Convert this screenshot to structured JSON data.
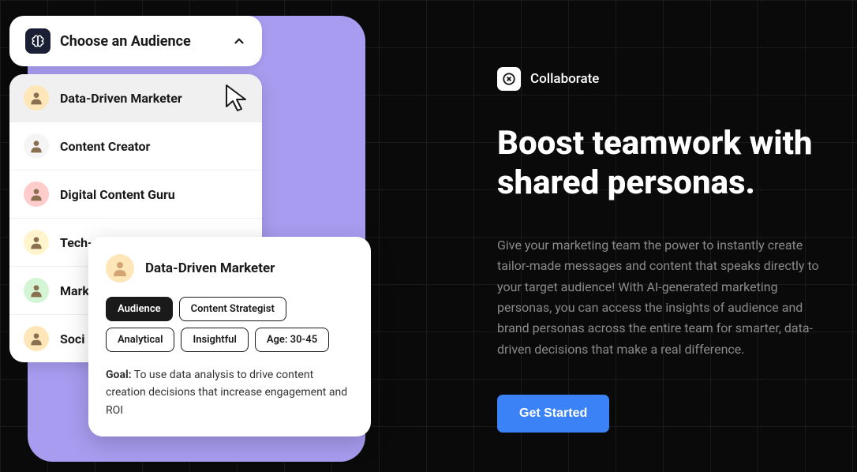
{
  "dropdown": {
    "label": "Choose an Audience",
    "items": [
      {
        "name": "Data-Driven Marketer",
        "selected": true,
        "avatar_bg": "#ffe6b8"
      },
      {
        "name": "Content Creator",
        "selected": false,
        "avatar_bg": "#f5f5f5"
      },
      {
        "name": "Digital Content Guru",
        "selected": false,
        "avatar_bg": "#ffcccc"
      },
      {
        "name": "Tech-savvy Influencer",
        "selected": false,
        "avatar_bg": "#fff4cc"
      },
      {
        "name": "Mark",
        "selected": false,
        "avatar_bg": "#d4f5d4"
      },
      {
        "name": "Soci",
        "selected": false,
        "avatar_bg": "#ffe6b8"
      }
    ]
  },
  "persona": {
    "title": "Data-Driven Marketer",
    "avatar_bg": "#ffe6b8",
    "tags": [
      {
        "label": "Audience",
        "active": true
      },
      {
        "label": "Content Strategist",
        "active": false
      },
      {
        "label": "Analytical",
        "active": false
      },
      {
        "label": "Insightful",
        "active": false
      },
      {
        "label": "Age: 30-45",
        "active": false
      }
    ],
    "goal_label": "Goal:",
    "goal_text": " To use data analysis to drive content creation decisions that increase engagement and ROI"
  },
  "right": {
    "badge": "Collaborate",
    "headline": "Boost teamwork with shared personas.",
    "description": "Give your marketing team the power to instantly create tailor-made messages and content that speaks directly to your target audience! With AI-generated marketing personas, you can access the insights of audience and brand personas across the entire team for smarter, data-driven decisions that make a real difference.",
    "cta": "Get Started"
  }
}
